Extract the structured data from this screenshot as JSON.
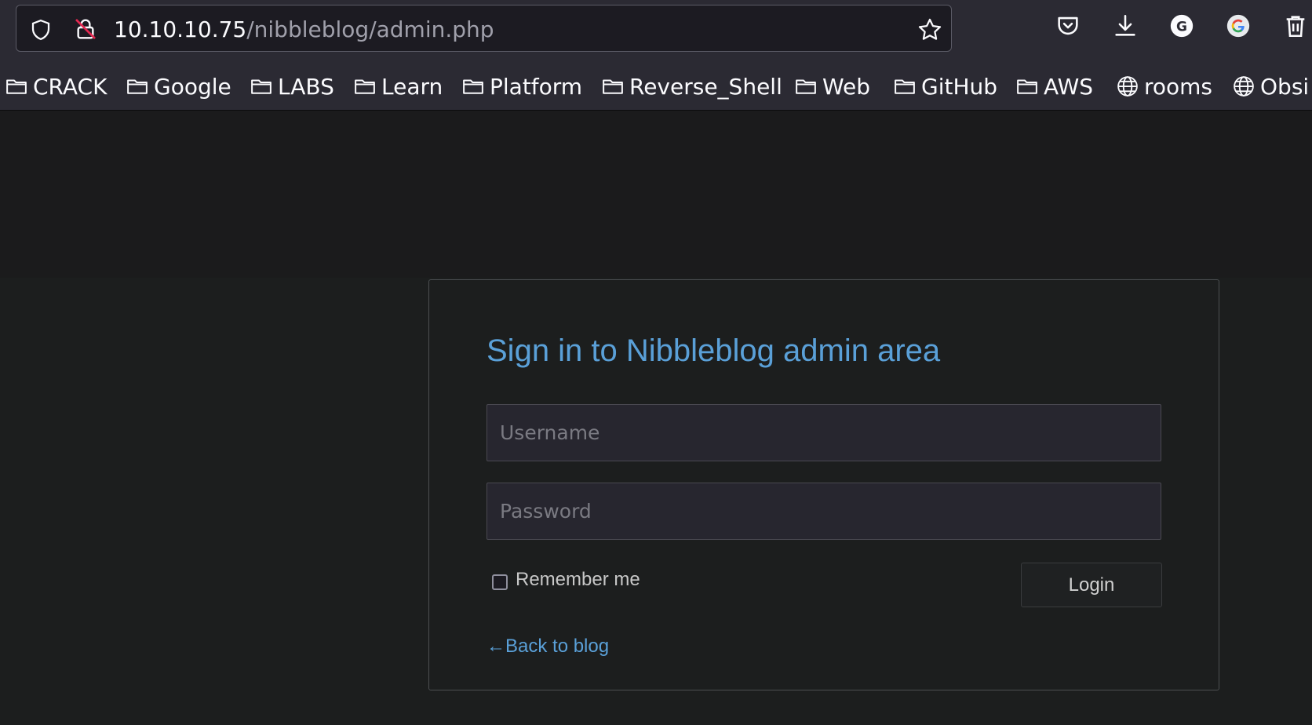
{
  "browser": {
    "url_host": "10.10.10.75",
    "url_path": "/nibbleblog/admin.php",
    "icons": [
      "shield-icon",
      "insecure-lock-icon",
      "bookmark-star-icon",
      "pocket-icon",
      "download-icon",
      "grammarly-g-icon",
      "google-extension-icon",
      "trash-icon"
    ]
  },
  "bookmarks": [
    {
      "label": "CRACK",
      "icon": "folder-icon"
    },
    {
      "label": "Google",
      "icon": "folder-icon"
    },
    {
      "label": "LABS",
      "icon": "folder-icon"
    },
    {
      "label": "Learn",
      "icon": "folder-icon"
    },
    {
      "label": "Platform",
      "icon": "folder-icon"
    },
    {
      "label": "Reverse_Shell",
      "icon": "folder-icon"
    },
    {
      "label": "Web",
      "icon": "folder-icon"
    },
    {
      "label": "GitHub",
      "icon": "folder-icon"
    },
    {
      "label": "AWS",
      "icon": "folder-icon"
    },
    {
      "label": "rooms",
      "icon": "globe-icon"
    },
    {
      "label": "Obsi",
      "icon": "globe-icon"
    }
  ],
  "login": {
    "title": "Sign in to Nibbleblog admin area",
    "username_placeholder": "Username",
    "username_value": "",
    "password_placeholder": "Password",
    "password_value": "",
    "remember_label": "Remember me",
    "remember_checked": false,
    "login_button": "Login",
    "back_link": "←Back to blog"
  },
  "colors": {
    "accent": "#5aa0d8",
    "page_bg": "#1c1e1e",
    "chrome_bg": "#2b2a33"
  }
}
